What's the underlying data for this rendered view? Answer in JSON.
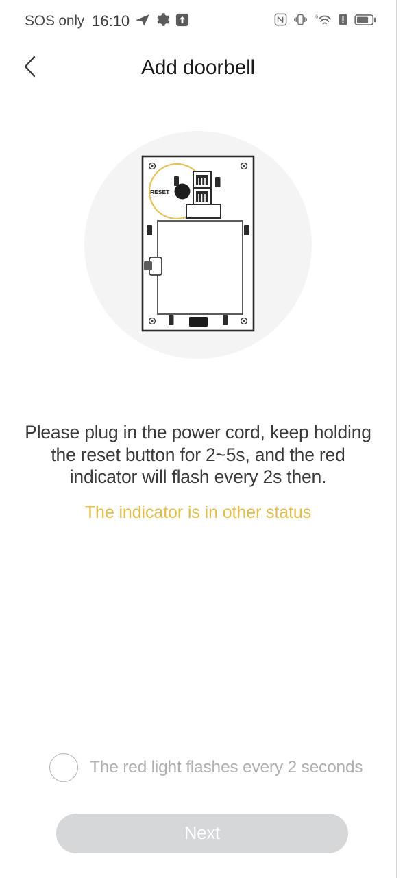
{
  "status_bar": {
    "carrier": "SOS only",
    "time": "16:10",
    "left_icons": [
      {
        "name": "telegram-paper-plane-icon"
      },
      {
        "name": "gear-icon"
      },
      {
        "name": "upload-arrow-icon"
      }
    ],
    "right_icons": [
      {
        "name": "nfc-icon"
      },
      {
        "name": "vibrate-icon"
      },
      {
        "name": "wifi-6-icon",
        "badge": "6"
      },
      {
        "name": "sim-alert-icon"
      },
      {
        "name": "battery-icon"
      }
    ]
  },
  "header": {
    "back_label": "Back",
    "title": "Add doorbell"
  },
  "illustration": {
    "name": "doorbell-backplate-diagram",
    "reset_label": "RESET",
    "highlight_color": "#e5c25a",
    "circle_bg": "#f4f4f4"
  },
  "main": {
    "instruction": "Please plug in the power cord, keep holding the reset button for 2~5s, and the red indicator will flash every 2s then.",
    "other_status_link": "The indicator is in other status",
    "link_color": "#e0bd4c"
  },
  "confirm": {
    "label": "The red light flashes every 2 seconds",
    "checked": false
  },
  "footer": {
    "next_label": "Next",
    "next_enabled": false,
    "next_bg": "#d6d7d8"
  }
}
